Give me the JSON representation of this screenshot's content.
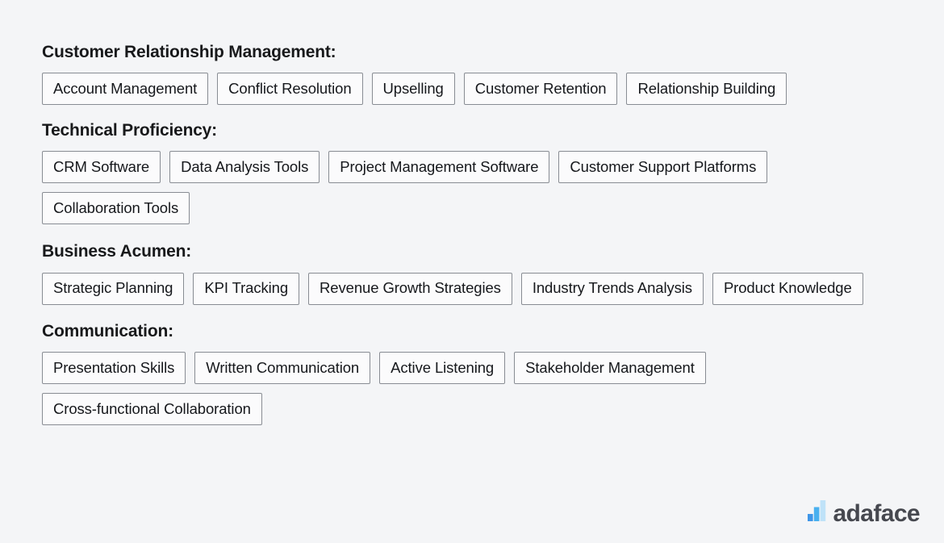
{
  "sections": [
    {
      "title": "Customer Relationship Management:",
      "skills": [
        "Account Management",
        "Conflict Resolution",
        "Upselling",
        "Customer Retention",
        "Relationship Building"
      ]
    },
    {
      "title": "Technical Proficiency:",
      "skills": [
        "CRM Software",
        "Data Analysis Tools",
        "Project Management Software",
        "Customer Support Platforms",
        "Collaboration Tools"
      ]
    },
    {
      "title": "Business Acumen:",
      "skills": [
        "Strategic Planning",
        "KPI Tracking",
        "Revenue Growth Strategies",
        "Industry Trends Analysis",
        "Product Knowledge"
      ]
    },
    {
      "title": "Communication:",
      "skills": [
        "Presentation Skills",
        "Written Communication",
        "Active Listening",
        "Stakeholder Management",
        "Cross-functional Collaboration"
      ]
    }
  ],
  "logo": {
    "text": "adaface",
    "mark_icon": "bar-chart-icon",
    "bar_colors": [
      "#3f96e8",
      "#49b0ef",
      "#bfe2f8"
    ],
    "text_color": "#46484f"
  },
  "colors": {
    "background": "#f4f5f7",
    "chip_fill": "#fbfbfc",
    "chip_border": "#888c93",
    "text": "#16181c",
    "heading": "#18191b"
  }
}
